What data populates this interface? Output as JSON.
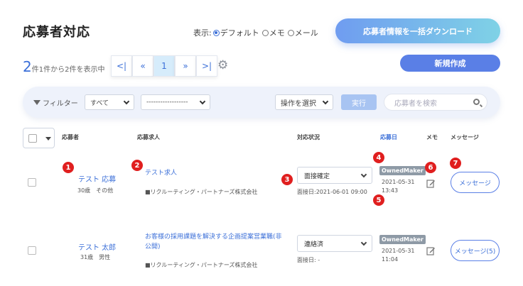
{
  "header": {
    "title": "応募者対応",
    "display_label": "表示:",
    "display_options": [
      "デフォルト",
      "メモ",
      "メール"
    ],
    "download_button": "応募者情報を一括ダウンロード",
    "new_button": "新規作成"
  },
  "summary": {
    "count": "2",
    "count_text": "件1件から2件を表示中"
  },
  "pager": {
    "first": "<|",
    "prev": "«",
    "page": "1",
    "next": "»",
    "last": ">|"
  },
  "filter": {
    "label": "フィルター",
    "scope": "すべて",
    "second": "------------------",
    "action": "操作を選択",
    "execute": "実行",
    "search_placeholder": "応募者を検索"
  },
  "table": {
    "columns": {
      "applicant": "応募者",
      "job": "応募求人",
      "status": "対応状況",
      "date": "応募日",
      "memo": "メモ",
      "message": "メッセージ"
    },
    "rows": [
      {
        "name": "テスト 応募",
        "info": "30歳　その他",
        "job": "テスト求人",
        "company": "■リクルーティング・パートナーズ株式会社",
        "status": "面接確定",
        "interview": "面接日:2021-06-01 09:00",
        "badge": "OwnedMaker",
        "date": "2021-05-31",
        "time": "13:43",
        "message": "メッセージ"
      },
      {
        "name": "テスト 太郎",
        "info": "31歳　男性",
        "job": "お客様の採用課題を解決する企画提案営業職(非公開)",
        "company": "■リクルーティング・パートナーズ株式会社",
        "status": "連絡済",
        "interview": "面接日: -",
        "badge": "OwnedMaker",
        "date": "2021-05-31",
        "time": "11:04",
        "message": "メッセージ(5)"
      }
    ]
  },
  "markers": [
    "1",
    "2",
    "3",
    "4",
    "5",
    "6",
    "7"
  ],
  "colors": {
    "accent": "#3b6fd8",
    "marker": "#e01f1f",
    "badge": "#8e9aa6"
  }
}
